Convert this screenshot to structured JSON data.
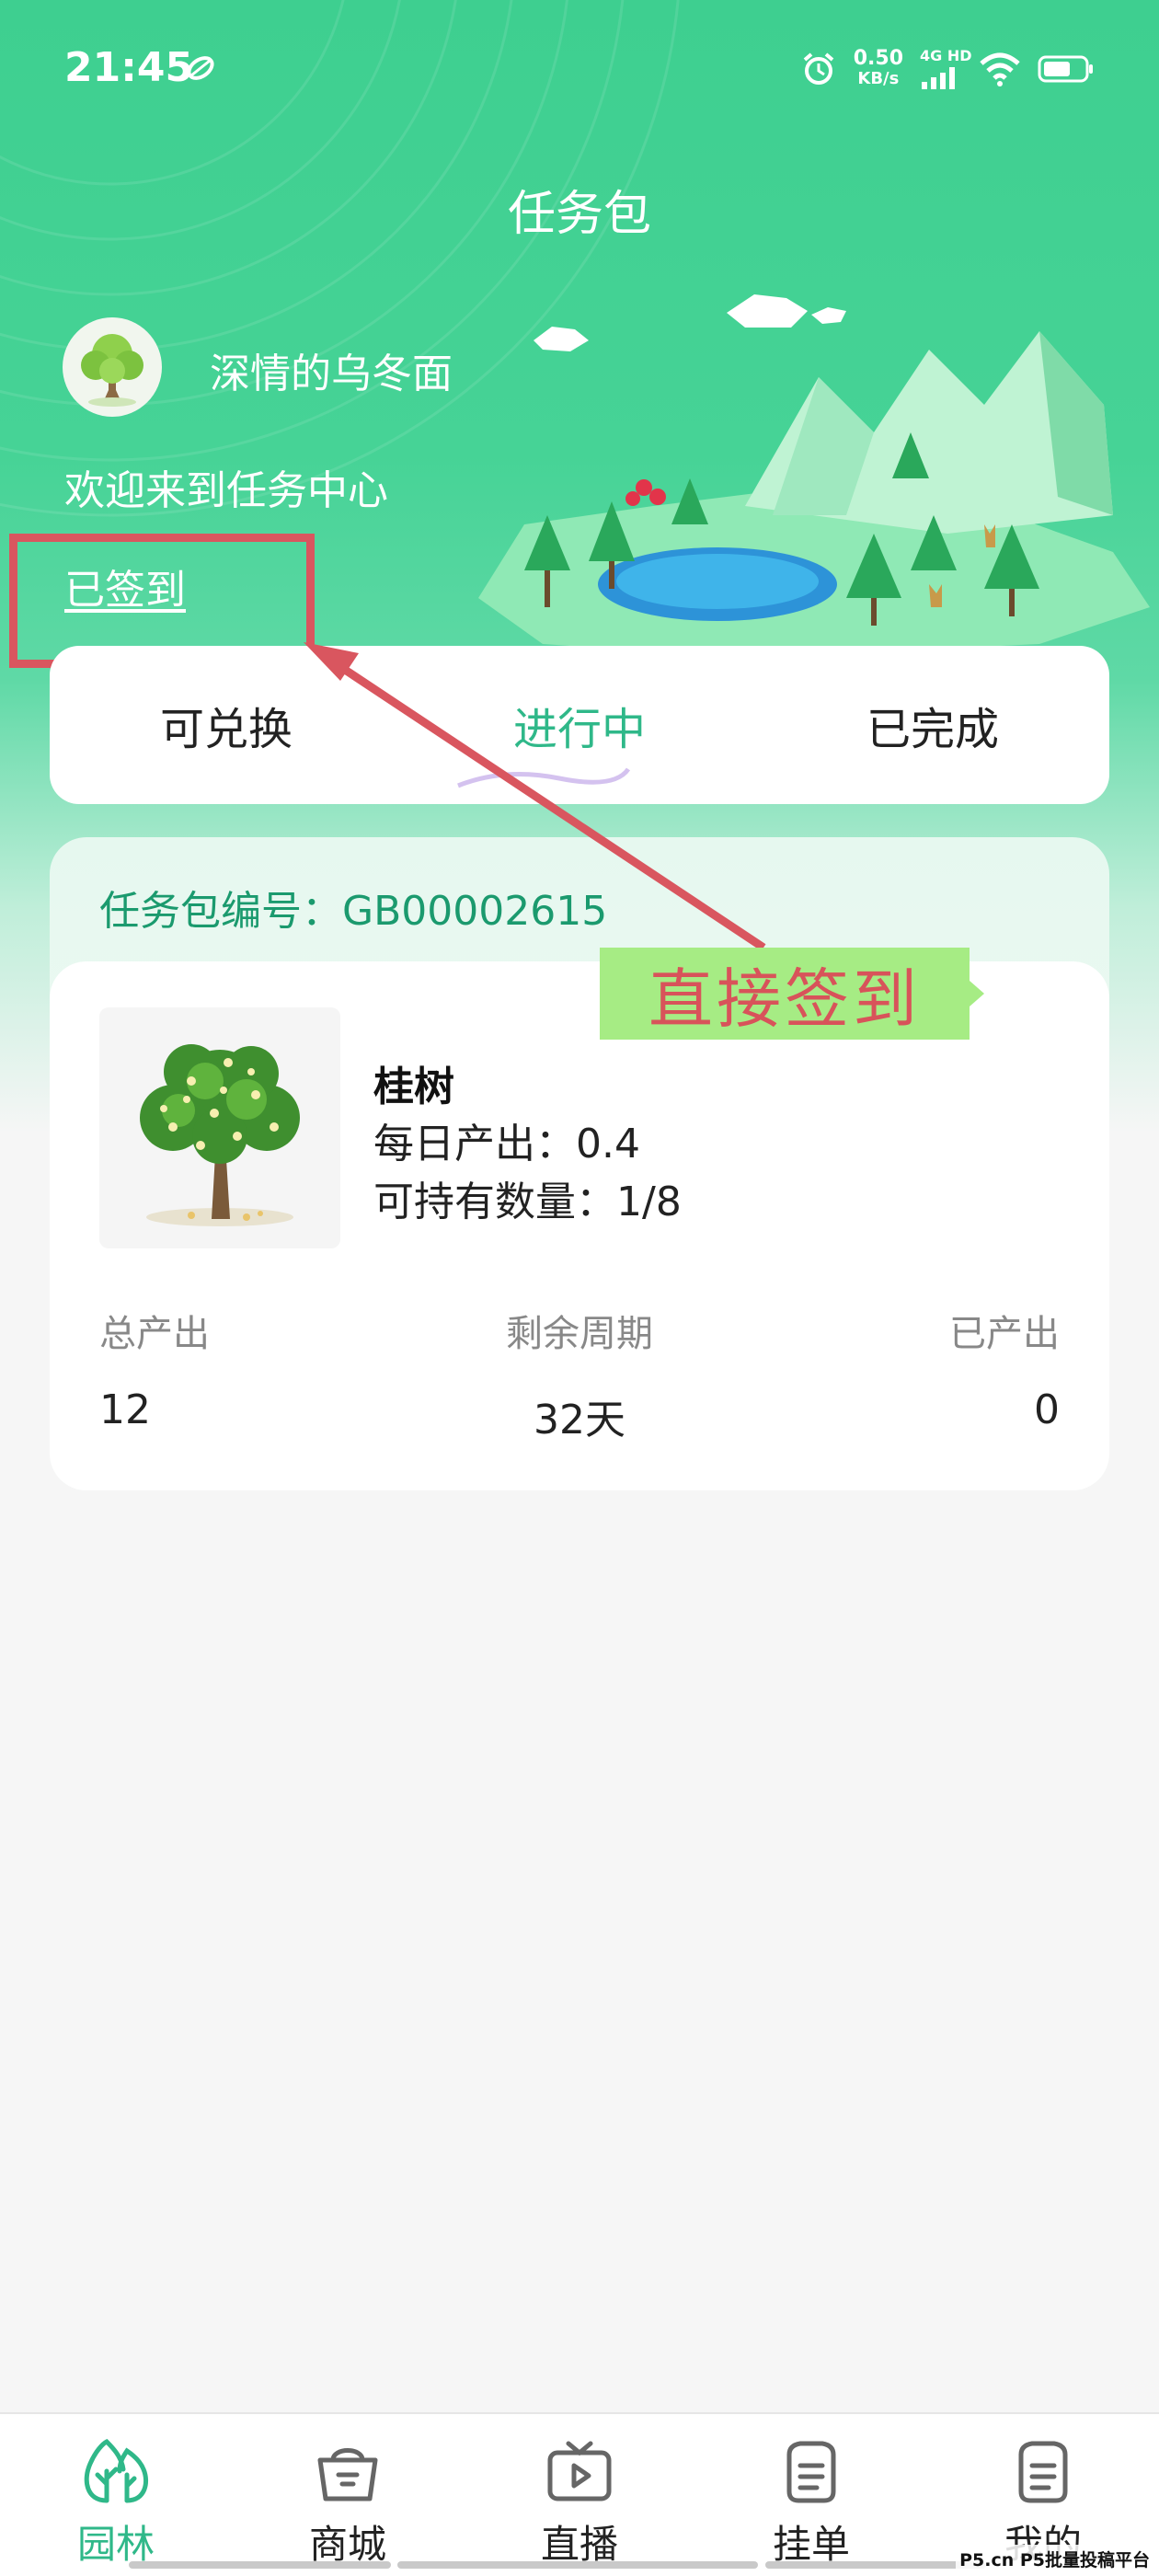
{
  "status_bar": {
    "time": "21:45",
    "speed_value": "0.50",
    "speed_unit": "KB/s",
    "network": "4G HD"
  },
  "page": {
    "title": "任务包"
  },
  "user": {
    "name": "深情的乌冬面",
    "welcome": "欢迎来到任务中心",
    "sign_status": "已签到"
  },
  "tabs": [
    {
      "label": "可兑换",
      "active": false
    },
    {
      "label": "进行中",
      "active": true
    },
    {
      "label": "已完成",
      "active": false
    }
  ],
  "package": {
    "number_text": "任务包编号：GB00002615",
    "product": {
      "name": "桂树",
      "daily_output": "每日产出：0.4",
      "holdable": "可持有数量：1/8"
    },
    "stats": [
      {
        "label": "总产出",
        "value": "12"
      },
      {
        "label": "剩余周期",
        "value": "32天"
      },
      {
        "label": "已产出",
        "value": "0"
      }
    ]
  },
  "annotation": {
    "text": "直接签到",
    "color": "#d9565f",
    "box_color": "#a6ec84"
  },
  "bottom_nav": [
    {
      "label": "园林",
      "icon": "tree-icon",
      "active": true
    },
    {
      "label": "商城",
      "icon": "basket-icon",
      "active": false
    },
    {
      "label": "直播",
      "icon": "tv-icon",
      "active": false
    },
    {
      "label": "挂单",
      "icon": "order-list-icon",
      "active": false
    },
    {
      "label": "我的",
      "icon": "profile-list-icon",
      "active": false
    }
  ],
  "watermark": "P5.cn P5批量投稿平台",
  "colors": {
    "accent": "#2fb889",
    "header_green": "#3ecf90"
  }
}
